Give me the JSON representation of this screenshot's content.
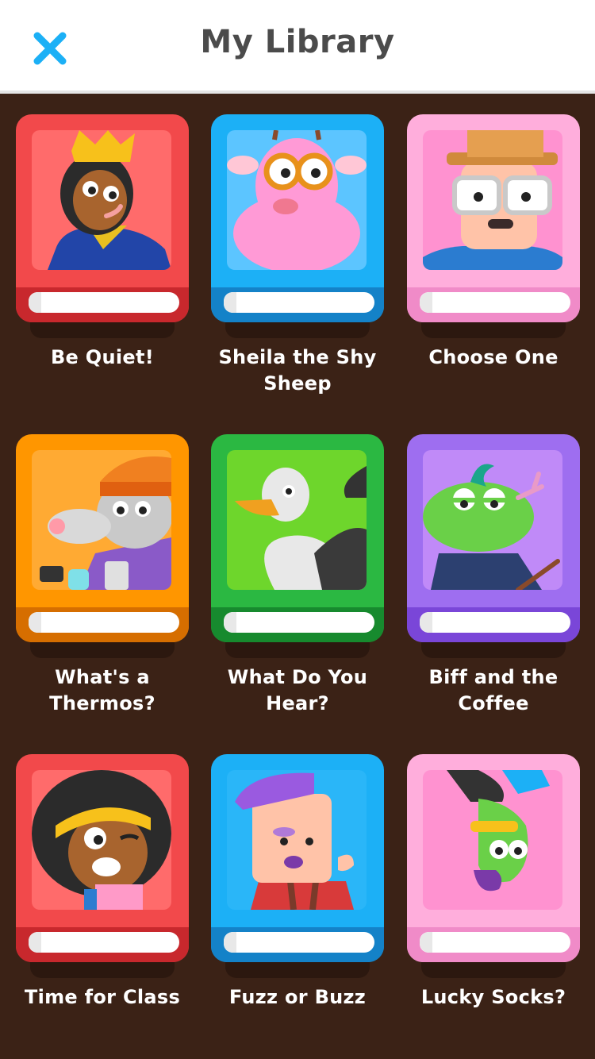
{
  "header": {
    "title": "My Library",
    "close_icon": "close-icon"
  },
  "colors": {
    "accent": "#1CB0F6",
    "background": "#3B2216"
  },
  "books": [
    {
      "title": "Be Quiet!",
      "cover_color": "#F2494B",
      "frame_color": "#FF6B6B",
      "spine_color": "#C8282D",
      "illustration": "crowned-girl-icon"
    },
    {
      "title": "Sheila the Shy Sheep",
      "cover_color": "#1CB0F6",
      "frame_color": "#5CC5FF",
      "spine_color": "#1482C8",
      "illustration": "pink-sheep-icon"
    },
    {
      "title": "Choose One",
      "cover_color": "#FFAEDC",
      "frame_color": "#FF92D0",
      "spine_color": "#F08BC8",
      "illustration": "man-with-hat-icon"
    },
    {
      "title": "What's a Thermos?",
      "cover_color": "#FF9600",
      "frame_color": "#FFAA33",
      "spine_color": "#D66E00",
      "illustration": "rat-with-beanie-icon"
    },
    {
      "title": "What Do You Hear?",
      "cover_color": "#2BB842",
      "frame_color": "#6ED62C",
      "spine_color": "#178A2E",
      "illustration": "seagull-icon"
    },
    {
      "title": "Biff and the Coffee",
      "cover_color": "#9E6EF0",
      "frame_color": "#C08AF8",
      "spine_color": "#7A46D8",
      "illustration": "crocodile-icon"
    },
    {
      "title": "Time for Class",
      "cover_color": "#F2494B",
      "frame_color": "#FF6B6B",
      "spine_color": "#C8282D",
      "illustration": "girl-with-headband-icon"
    },
    {
      "title": "Fuzz or Buzz",
      "cover_color": "#1CB0F6",
      "frame_color": "#2AB6F8",
      "spine_color": "#1482C8",
      "illustration": "purple-haired-man-icon"
    },
    {
      "title": "Lucky Socks?",
      "cover_color": "#FFAEDC",
      "frame_color": "#FF92D0",
      "spine_color": "#F08BC8",
      "illustration": "upside-down-lizard-icon"
    }
  ]
}
